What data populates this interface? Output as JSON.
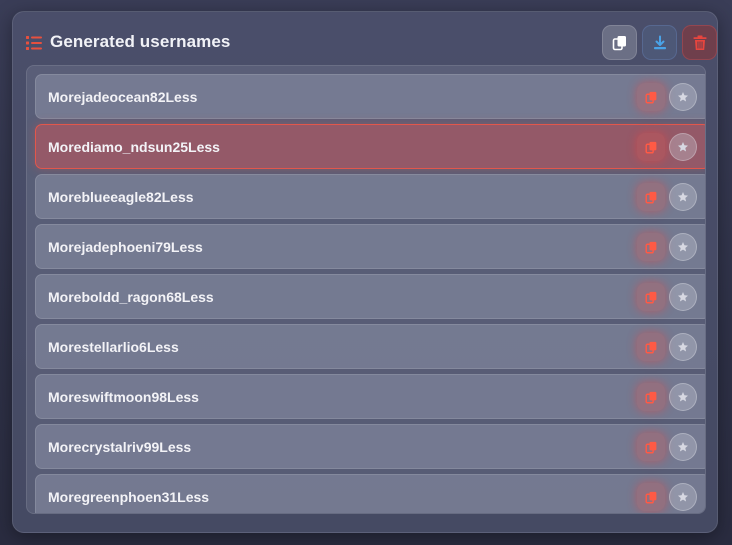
{
  "header": {
    "title": "Generated usernames",
    "icons": {
      "list": "list-icon",
      "copy": "copy-icon",
      "download": "download-icon",
      "delete": "trash-icon"
    }
  },
  "colors": {
    "accent": "#e8503e",
    "download": "#4aa3e8",
    "delete": "#e8453e"
  },
  "usernames": [
    {
      "name": "Morejadeocean82Less",
      "highlighted": false
    },
    {
      "name": "Morediamo_ndsun25Less",
      "highlighted": true
    },
    {
      "name": "Moreblueeagle82Less",
      "highlighted": false
    },
    {
      "name": "Morejadephoeni79Less",
      "highlighted": false
    },
    {
      "name": "Moreboldd_ragon68Less",
      "highlighted": false
    },
    {
      "name": "Morestellarlio6Less",
      "highlighted": false
    },
    {
      "name": "Moreswiftmoon98Less",
      "highlighted": false
    },
    {
      "name": "Morecrystalriv99Less",
      "highlighted": false
    },
    {
      "name": "Moregreenphoen31Less",
      "highlighted": false
    }
  ]
}
